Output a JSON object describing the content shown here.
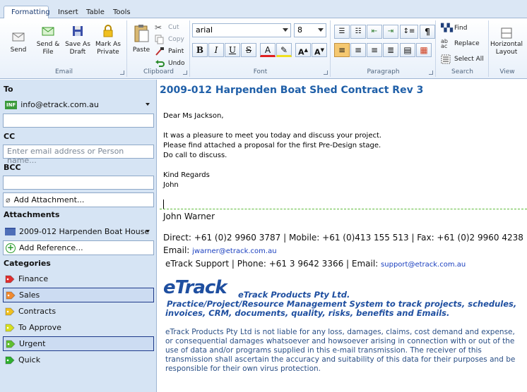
{
  "tabs": [
    "Formatting",
    "Insert",
    "Table",
    "Tools"
  ],
  "email_group": {
    "label": "Email",
    "buttons": [
      "Send",
      "Send &\nFile",
      "Save As\nDraft",
      "Mark As\nPrivate"
    ]
  },
  "clipboard": {
    "label": "Clipboard",
    "paste": "Paste",
    "cut": "Cut",
    "copy": "Copy",
    "paint": "Paint",
    "undo": "Undo"
  },
  "font": {
    "label": "Font",
    "family": "arial",
    "size": "8"
  },
  "paragraph": {
    "label": "Paragraph"
  },
  "search": {
    "label": "Search",
    "find": "Find",
    "replace": "Replace",
    "select_all": "Select All"
  },
  "view": {
    "label": "View",
    "horizontal": "Horizontal\nLayout"
  },
  "left": {
    "to_label": "To",
    "to_value": "info@etrack.com.au",
    "to_badge": "INF",
    "cc_label": "CC",
    "cc_placeholder": "Enter email address or Person name...",
    "bcc_label": "BCC",
    "add_attachment": "Add Attachment...",
    "attachments_label": "Attachments",
    "attachment_item": "2009-012 Harpenden Boat House",
    "add_reference": "Add Reference...",
    "categories_label": "Categories",
    "categories": [
      {
        "name": "Finance",
        "color": "#e03030",
        "selected": false
      },
      {
        "name": "Sales",
        "color": "#f08a30",
        "selected": true
      },
      {
        "name": "Contracts",
        "color": "#f0c020",
        "selected": false
      },
      {
        "name": "To Approve",
        "color": "#d8e020",
        "selected": false
      },
      {
        "name": "Urgent",
        "color": "#60c030",
        "selected": true
      },
      {
        "name": "Quick",
        "color": "#30b030",
        "selected": false
      }
    ]
  },
  "message": {
    "subject": "2009-012 Harpenden Boat Shed Contract Rev 3",
    "lines": [
      "Dear Ms Jackson,",
      "It was a pleasure to meet you today and discuss your project.",
      "Please find attached a proposal for the first Pre-Design stage.",
      "Do call to discuss.",
      "Kind Regards",
      "John"
    ],
    "sig_name": "John Warner",
    "sig_contact": "Direct:  +61 (0)2 9960 3787 |  Mobile: +61 (0)413 155 513 |  Fax:  +61 (0)2 9960 4238 |",
    "sig_email_label": "Email: ",
    "sig_email": "jwarner@etrack.com.au",
    "support_line": "eTrack Support | Phone: +61 3 9642 3366 | Email: ",
    "support_email": "support@etrack.com.au",
    "logo": "eTrack",
    "company": "eTrack Products Pty Ltd.",
    "tagline1": "Practice/Project/Resource Management System to track projects, schedules,",
    "tagline2": "invoices, CRM, documents, quality, risks, benefits and Emails.",
    "disclaimer": "eTrack Products Pty Ltd is not liable for any loss, damages, claims, cost demand and expense, or consequential damages whatsoever and howsoever arising in connection with or out of the use of data and/or programs supplied in this e-mail transmission. The receiver of this transmission shall ascertain the accuracy and suitability of this data for their purposes and be responsible for their own virus protection."
  }
}
